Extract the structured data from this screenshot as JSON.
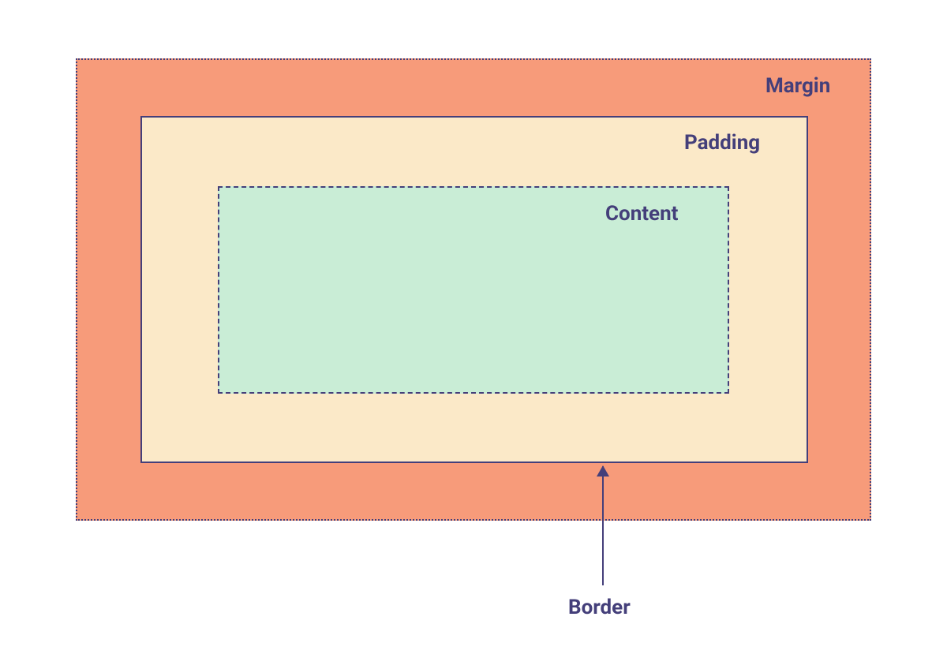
{
  "diagram": {
    "type": "css-box-model",
    "labels": {
      "margin": "Margin",
      "padding": "Padding",
      "content": "Content",
      "border": "Border"
    },
    "colors": {
      "margin_fill": "#f79b7a",
      "padding_fill": "#fbe9c8",
      "content_fill": "#c9edd6",
      "stroke": "#443f7a",
      "text": "#443f7a"
    },
    "borders": {
      "margin": "dotted",
      "padding": "solid",
      "content": "dashed"
    }
  }
}
